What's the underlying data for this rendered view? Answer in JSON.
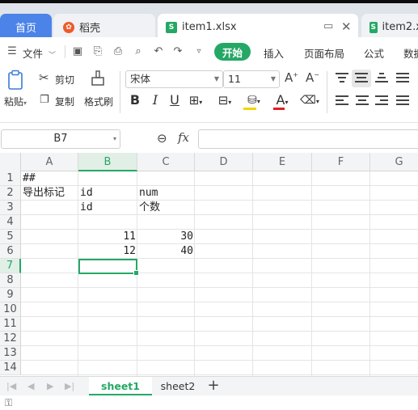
{
  "tabs": {
    "home": "首页",
    "docer": "稻壳",
    "item1": "item1.xlsx",
    "item2": "item2.x"
  },
  "menu": {
    "file": "文件",
    "start": "开始",
    "insert": "插入",
    "page_layout": "页面布局",
    "formula": "公式",
    "data": "数据"
  },
  "ribbon": {
    "paste": "粘贴",
    "cut": "剪切",
    "copy": "复制",
    "format_painter": "格式刷",
    "font_name": "宋体",
    "font_size": "11"
  },
  "formula_bar": {
    "name_box": "B7",
    "fx": "fx",
    "formula": ""
  },
  "grid": {
    "columns": [
      "A",
      "B",
      "C",
      "D",
      "E",
      "F",
      "G"
    ],
    "rows": [
      "1",
      "2",
      "3",
      "4",
      "5",
      "6",
      "7",
      "8",
      "9",
      "10",
      "11",
      "12",
      "13",
      "14"
    ],
    "cells": {
      "A1": "##",
      "A2": "导出标记",
      "B2": "id",
      "C2": "num",
      "B3": "id",
      "C3": "个数",
      "B5": "11",
      "C5": "30",
      "B6": "12",
      "C6": "40"
    },
    "selected_cell": "B7"
  },
  "sheets": [
    "sheet1",
    "sheet2"
  ],
  "colors": {
    "accent": "#25a866",
    "home_tab": "#4b83e8"
  }
}
